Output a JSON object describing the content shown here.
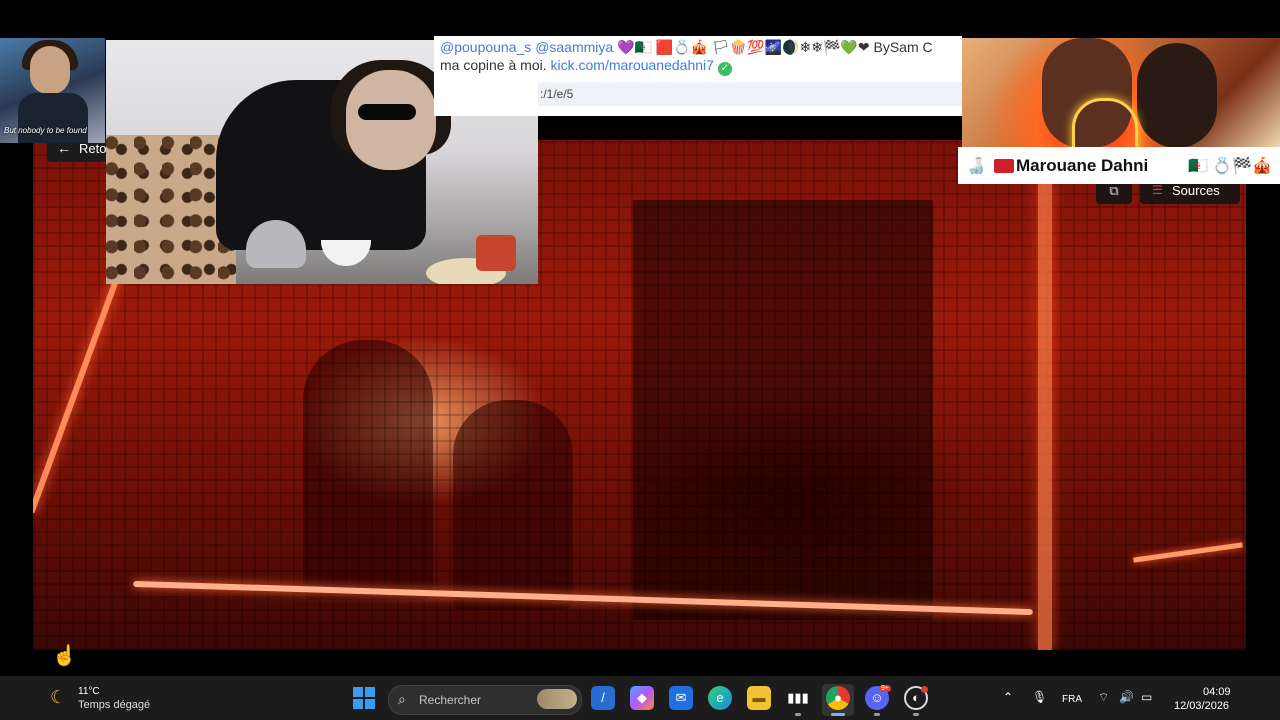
{
  "stream": {
    "back_label": "Reto",
    "sources_label": "Sources"
  },
  "small_cam": {
    "caption": "But nobody to be found"
  },
  "chat": {
    "mention1": "@poupouna_s",
    "mention2": "@saammiya",
    "emoji_line": "💜🇩🇿 🟥💍🎪 🏳🍿💯🌌🌒❄❄🏁💚❤",
    "signature": "BySam C",
    "line2_text": "ma copine à moi.",
    "link": "kick.com/marouanedahni7",
    "url_fragment": ":/1/e/5"
  },
  "overlay": {
    "name": "Marouane Dahni",
    "name_emojis": "🇩🇿 💍🏁🎪"
  },
  "taskbar": {
    "weather_temp": "11°C",
    "weather_desc": "Temps dégagé",
    "search_label": "Rechercher",
    "language": "FRA",
    "time": "04:09",
    "date": "12/03/2026",
    "discord_badge": "9+"
  },
  "icons": {
    "back": "arrow-left-icon",
    "sources": "list-icon",
    "external": "external-link-icon",
    "search": "search-icon",
    "weather": "moon-icon",
    "cursor": "hand-pointer-icon"
  },
  "colors": {
    "mention": "#4a7bd0",
    "link": "#3f7ed8",
    "verified": "#3cbf5f",
    "taskbar": "#1c1c1c"
  }
}
